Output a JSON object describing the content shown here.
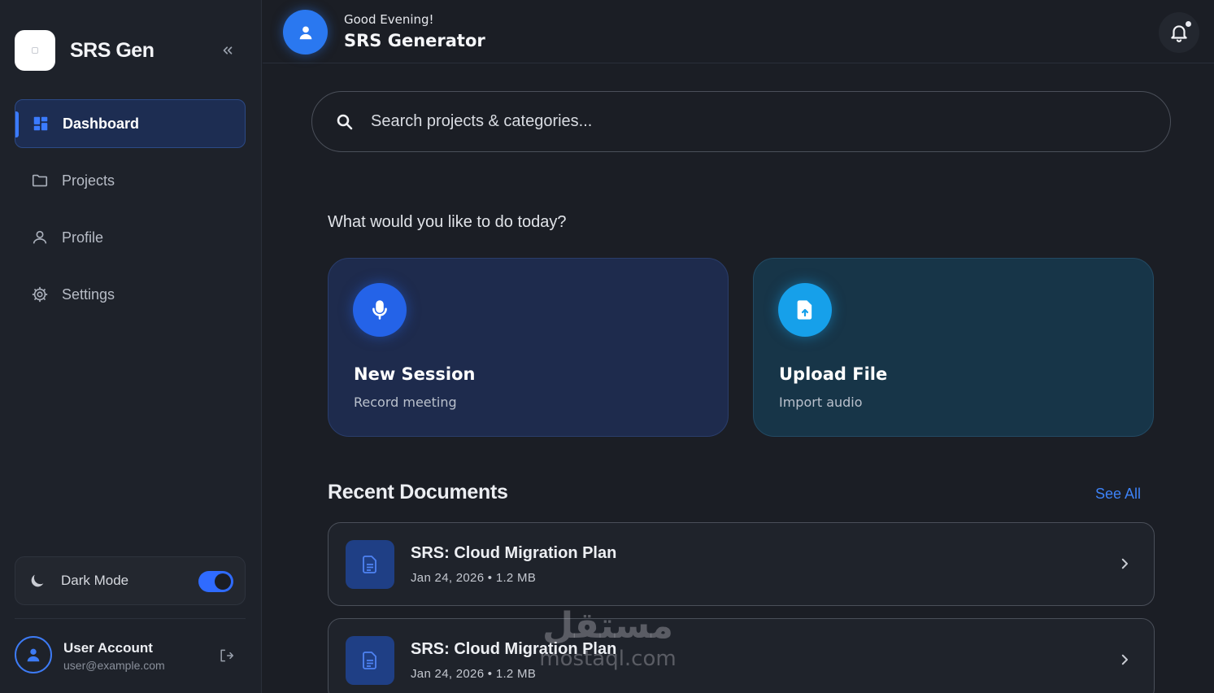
{
  "sidebar": {
    "brand_name": "SRS Gen",
    "nav": [
      {
        "label": "Dashboard",
        "icon": "dashboard-icon",
        "active": true
      },
      {
        "label": "Projects",
        "icon": "folder-icon",
        "active": false
      },
      {
        "label": "Profile",
        "icon": "user-icon",
        "active": false
      },
      {
        "label": "Settings",
        "icon": "gear-icon",
        "active": false
      }
    ],
    "dark_mode": {
      "label": "Dark Mode",
      "enabled": true
    },
    "user": {
      "name": "User Account",
      "email": "user@example.com"
    }
  },
  "header": {
    "greeting": "Good Evening!",
    "title": "SRS Generator"
  },
  "search": {
    "placeholder": "Search projects & categories..."
  },
  "main": {
    "prompt": "What would you like to do today?",
    "actions": [
      {
        "title": "New Session",
        "subtitle": "Record meeting",
        "icon": "microphone-icon"
      },
      {
        "title": "Upload File",
        "subtitle": "Import audio",
        "icon": "file-upload-icon"
      }
    ],
    "recent": {
      "title": "Recent Documents",
      "see_all": "See All",
      "documents": [
        {
          "title": "SRS: Cloud Migration Plan",
          "meta": "Jan 24, 2026 • 1.2 MB"
        },
        {
          "title": "SRS: Cloud Migration Plan",
          "meta": "Jan 24, 2026 • 1.2 MB"
        }
      ]
    }
  },
  "watermark": {
    "arabic": "مستقل",
    "latin": "mostaql.com"
  },
  "colors": {
    "accent": "#3b7bff",
    "background": "#1b1e25",
    "sidebar": "#1e222a",
    "link": "#3d82f6"
  }
}
